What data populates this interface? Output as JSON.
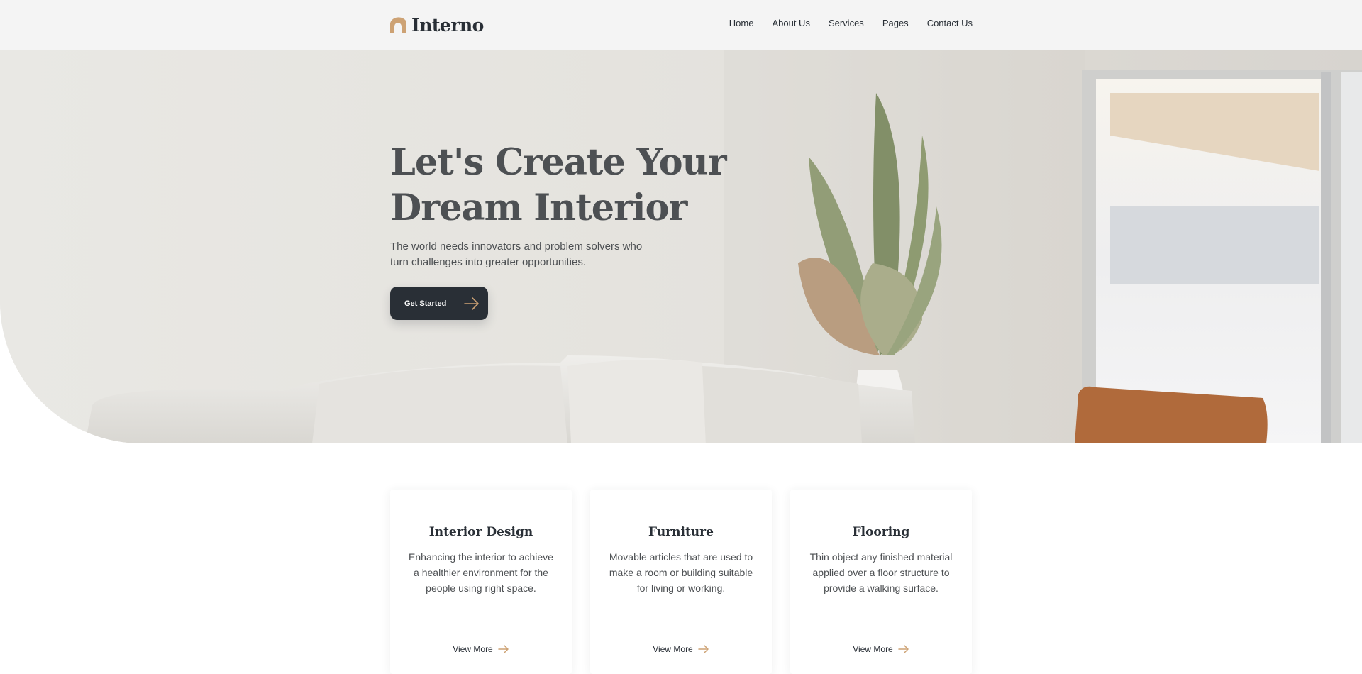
{
  "brand": {
    "name": "Interno",
    "logo_icon": "arch-logo-icon",
    "accent_color": "#cda274"
  },
  "nav": {
    "items": [
      {
        "label": "Home"
      },
      {
        "label": "About Us"
      },
      {
        "label": "Services"
      },
      {
        "label": "Pages"
      },
      {
        "label": "Contact Us"
      }
    ]
  },
  "hero": {
    "title": "Let's Create Your Dream Interior",
    "subtitle": "The world needs innovators and problem solvers who turn challenges into greater opportunities.",
    "cta_label": "Get Started",
    "cta_icon": "arrow-right-icon",
    "background_image": "living-room-photo"
  },
  "services": {
    "cards": [
      {
        "title": "Interior Design",
        "description": "Enhancing the interior to achieve a healthier environment for the people using right space.",
        "link_label": "View More",
        "link_icon": "arrow-right-icon"
      },
      {
        "title": "Furniture",
        "description": "Movable articles that are used to make a room or building suitable for living or working.",
        "link_label": "View More",
        "link_icon": "arrow-right-icon"
      },
      {
        "title": "Flooring",
        "description": "Thin object any finished material applied over a floor structure to provide a walking surface.",
        "link_label": "View More",
        "link_icon": "arrow-right-icon"
      }
    ]
  },
  "colors": {
    "primary_dark": "#292f36",
    "text_gray": "#4d5053",
    "accent": "#cda274",
    "nav_bg": "#f4f4f4"
  }
}
